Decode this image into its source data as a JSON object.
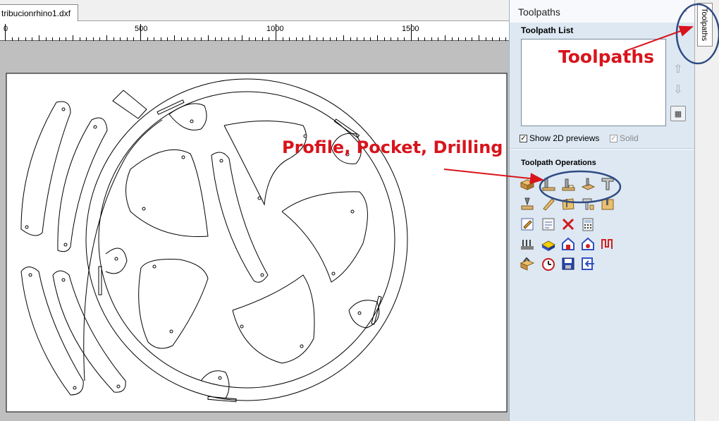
{
  "document": {
    "tab_label": "tribucionrhino1.dxf",
    "ruler_labels": [
      "0",
      "500",
      "1000",
      "1500"
    ]
  },
  "panel": {
    "title": "Toolpaths",
    "list_title": "Toolpath List",
    "show_2d_label": "Show 2D previews",
    "show_2d_checked": true,
    "solid_label": "Solid",
    "solid_checked": true,
    "operations_title": "Toolpath Operations",
    "side_tab_label": "Toolpaths",
    "icons": {
      "up": "arrow-up-icon",
      "down": "arrow-down-icon",
      "calculate": "calculator-icon",
      "pin": "pin-icon"
    }
  },
  "annotations": {
    "toolpaths": "Toolpaths",
    "operations": "Profile, Pocket, Drilling",
    "color": "#d8141c",
    "circle_color": "#2e4b82"
  }
}
